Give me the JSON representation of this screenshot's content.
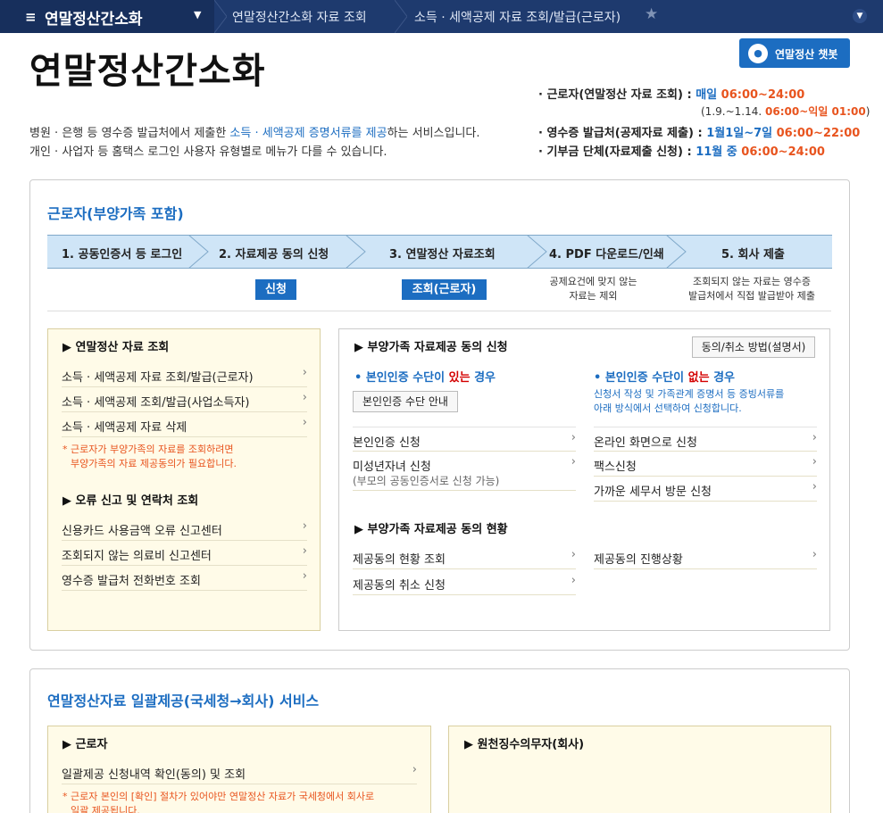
{
  "topnav": {
    "menu_icon": "hamburger-icon",
    "title": "연말정산간소화",
    "crumb1": "연말정산간소화 자료 조회",
    "crumb2": "소득 · 세액공제 자료 조회/발급(근로자)"
  },
  "page_title": "연말정산간소화",
  "chatbot": {
    "label": "연말정산 챗봇"
  },
  "intro": {
    "line1_pre": "병원 · 은행 등 영수증 발급처에서 제출한 ",
    "line1_highlight": "소득 · 세액공제 증명서류를 제공",
    "line1_post": "하는 서비스입니다.",
    "line2": "개인 · 사업자 등 홈택스 로그인 사용자 유형별로 메뉴가 다를 수 있습니다."
  },
  "schedule": [
    {
      "label": "· 근로자(연말정산 자료 조회) :",
      "pre": "매일",
      "time": "06:00~24:00"
    },
    {
      "label": "· 영수증 발급처(공제자료 제출) :",
      "pre": "1월1일~7일",
      "time": "06:00~22:00"
    },
    {
      "label": "· 기부금 단체(자료제출 신청) :",
      "pre": "11월 중",
      "time": "06:00~24:00"
    }
  ],
  "schedule_sub": {
    "pre": "(1.9.~1.14.",
    "time": "06:00~익일 01:00",
    "post": ")"
  },
  "section1": {
    "title": "근로자(부양가족 포함)",
    "steps": [
      "1. 공동인증서 등 로그인",
      "2. 자료제공 동의 신청",
      "3. 연말정산 자료조회",
      "4. PDF 다운로드/인쇄",
      "5. 회사 제출"
    ],
    "btn_apply": "신청",
    "btn_view": "조회(근로자)",
    "note4_l1": "공제요건에 맞지 않는",
    "note4_l2": "자료는 제외",
    "note5_l1": "조회되지 않는 자료는 영수증",
    "note5_l2": "발급처에서 직접 발급받아 제출"
  },
  "left_box": {
    "head1": "연말정산 자료 조회",
    "items1": [
      "소득 · 세액공제 자료 조회/발급(근로자)",
      "소득 · 세액공제 조회/발급(사업소득자)",
      "소득 · 세액공제 자료 삭제"
    ],
    "note_l1": "* 근로자가 부양가족의 자료를 조회하려면",
    "note_l2": "부양가족의 자료 제공동의가 필요합니다.",
    "head2": "오류 신고 및 연락처 조회",
    "items2": [
      "신용카드 사용금액 오류 신고센터",
      "조회되지 않는 의료비 신고센터",
      "영수증 발급처 전화번호 조회"
    ]
  },
  "right_box": {
    "head1": "부양가족 자료제공 동의 신청",
    "guide_btn": "동의/취소 방법(설명서)",
    "left_sub_pre": "본인인증 수단이 ",
    "left_sub_red": "있는",
    "left_sub_post": " 경우",
    "auth_guide_btn": "본인인증 수단 안내",
    "right_sub_pre": "본인인증 수단이 ",
    "right_sub_red": "없는",
    "right_sub_post": " 경우",
    "right_note_l1": "신청서 작성 및 가족관계 증명서 등 증빙서류를",
    "right_note_l2": "아래 방식에서 선택하여 신청합니다.",
    "left_items": [
      "본인인증 신청",
      "미성년자녀 신청"
    ],
    "minor_sub": "(부모의 공동인증서로 신청 가능)",
    "right_items": [
      "온라인 화면으로 신청",
      "팩스신청",
      "가까운 세무서 방문 신청"
    ],
    "head2": "부양가족 자료제공 동의 현황",
    "status_left": [
      "제공동의 현황 조회",
      "제공동의 취소 신청"
    ],
    "status_right": [
      "제공동의 진행상황"
    ]
  },
  "section2": {
    "title": "연말정산자료 일괄제공(국세청→회사) 서비스",
    "left_head": "근로자",
    "left_item": "일괄제공 신청내역 확인(동의) 및 조회",
    "left_note_l1": "* 근로자 본인의 [확인] 절차가 있어야만 연말정산 자료가 국세청에서 회사로",
    "left_note_l2": "일괄 제공됩니다.",
    "right_head": "원천징수의무자(회사)"
  },
  "colors": {
    "brand_blue": "#1c6dc1",
    "nav": "#1e3a6e",
    "orange": "#e8541e",
    "red": "#d40000",
    "steps_bg": "#cfe5f7",
    "yellow_box": "#fffbe8"
  }
}
